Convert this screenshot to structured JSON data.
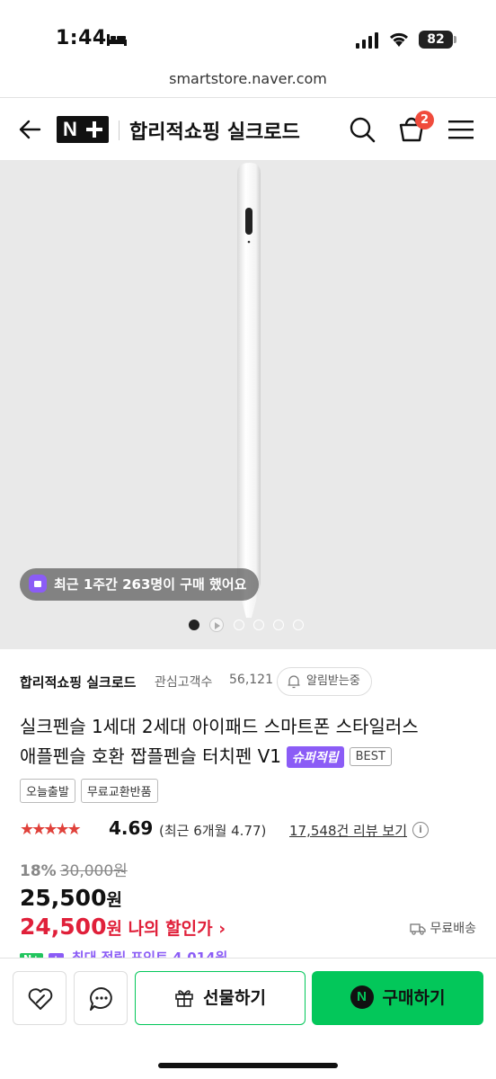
{
  "status": {
    "time": "1:44",
    "battery": "82"
  },
  "browser": {
    "url": "smartstore.naver.com"
  },
  "header": {
    "logo": "N+",
    "store_name": "합리적쇼핑 실크로드",
    "cart_count": "2"
  },
  "gallery": {
    "toast": "최근 1주간 263명이 구매 했어요",
    "slide_count": 6,
    "active_index": 0
  },
  "seller": {
    "name": "합리적쇼핑 실크로드",
    "interest_label": "관심고객수",
    "interest_count": "56,121",
    "notify_label": "알림받는중"
  },
  "product": {
    "title_line1": "실크펜슬 1세대 2세대 아이패드 스마트폰 스타일러스",
    "title_line2": "애플펜슬 호환 짭플펜슬 터치펜 V1",
    "badge_super": "슈퍼적립",
    "badge_best": "BEST",
    "tags": [
      "오늘출발",
      "무료교환반품"
    ]
  },
  "rating": {
    "stars": "★★★★★",
    "value": "4.69",
    "recent": "(최근 6개월 4.77)",
    "review_link": "17,548건 리뷰 보기",
    "info_glyph": "i"
  },
  "price": {
    "discount_rate": "18%",
    "original": "30,000원",
    "sale": "25,500",
    "unit": "원",
    "my_price": "24,500",
    "my_price_text": "원 나의 할인가 ›",
    "shipping": "무료배송",
    "points_peek": "최대 적립 포인트 4,014원"
  },
  "actions": {
    "gift_label": "선물하기",
    "buy_label": "구매하기",
    "npay_glyph": "N"
  },
  "colors": {
    "brand_green": "#03c75a",
    "sale_red": "#e0203a",
    "accent_purple": "#8b5cf6",
    "star_red": "#e0413a"
  }
}
